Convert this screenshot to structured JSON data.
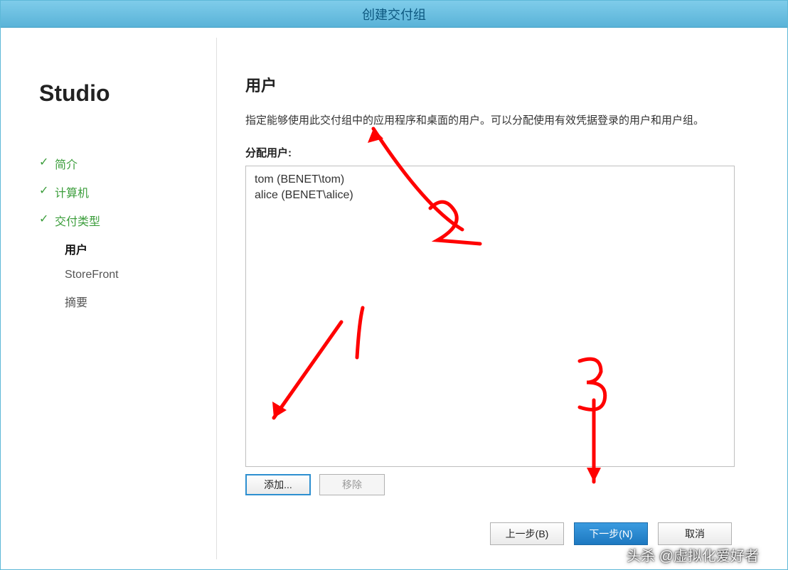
{
  "window": {
    "title": "创建交付组"
  },
  "sidebar": {
    "product": "Studio",
    "steps": [
      {
        "label": "简介",
        "state": "completed"
      },
      {
        "label": "计算机",
        "state": "completed"
      },
      {
        "label": "交付类型",
        "state": "completed"
      },
      {
        "label": "用户",
        "state": "current"
      },
      {
        "label": "StoreFront",
        "state": "pending"
      },
      {
        "label": "摘要",
        "state": "pending"
      }
    ]
  },
  "main": {
    "title": "用户",
    "description": "指定能够使用此交付组中的应用程序和桌面的用户。可以分配使用有效凭据登录的用户和用户组。",
    "assign_label": "分配用户:",
    "users": [
      "tom (BENET\\tom)",
      "alice (BENET\\alice)"
    ],
    "buttons": {
      "add": "添加...",
      "remove": "移除"
    }
  },
  "footer": {
    "back": "上一步(B)",
    "next": "下一步(N)",
    "cancel": "取消"
  },
  "watermark": "头杀 @虚拟化爱好者",
  "annotations": {
    "num1": "1",
    "num2": "2",
    "num3": "3"
  }
}
